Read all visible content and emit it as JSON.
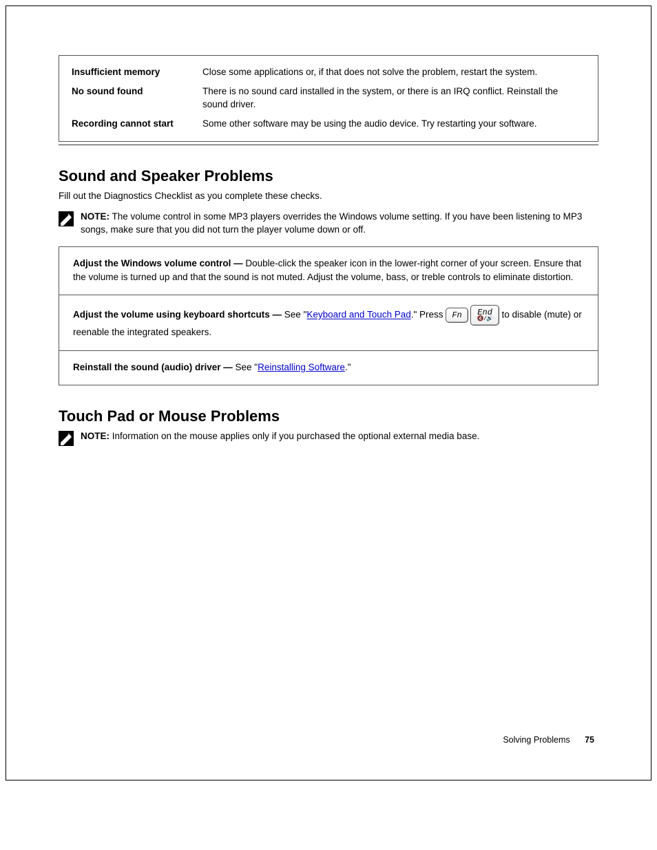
{
  "topbox": {
    "r1_label": "Insufficient memory",
    "r1_text": "Close some applications or, if that does not solve the problem, restart the system.",
    "r2_label": "No sound found",
    "r2_text": "There is no sound card installed in the system, or there is an IRQ conflict. Reinstall the sound driver.",
    "r3_label": "Recording cannot start",
    "r3_text": "Some other software may be using the audio device. Try restarting your software."
  },
  "section_title": "Sound and Speaker Problems",
  "intro": "Fill out the Diagnostics Checklist as you complete these checks.",
  "note_label": "NOTE:",
  "note_text": " The volume control in some MP3 players overrides the Windows volume setting. If you have been listening to MP3 songs, make sure that you did not turn the player volume down or off.",
  "checks": {
    "r1_title": "Adjust the Windows volume control —",
    "r1_text": " Double-click the speaker icon in the lower-right corner of your screen. Ensure that the volume is turned up and that the sound is not muted. Adjust the volume, bass, or treble controls to eliminate distortion.",
    "r2_title": "Adjust the volume using keyboard shortcuts —",
    "r2_pre": " See \"",
    "r2_link": "Keyboard and Touch Pad",
    "r2_post": ".\" Press ",
    "r2_tail": " to disable (mute) or reenable the integrated speakers.",
    "r3_title": "Reinstall the sound (audio) driver —",
    "r3_pre": " See \"",
    "r3_link": "Reinstalling Software",
    "r3_post": ".\""
  },
  "section2_title": "Touch Pad or Mouse Problems",
  "note2_label": "NOTE:",
  "note2_text": " Information on the mouse applies only if you purchased the optional external media base.",
  "footer_text": "Solving Problems",
  "footer_page": "75"
}
